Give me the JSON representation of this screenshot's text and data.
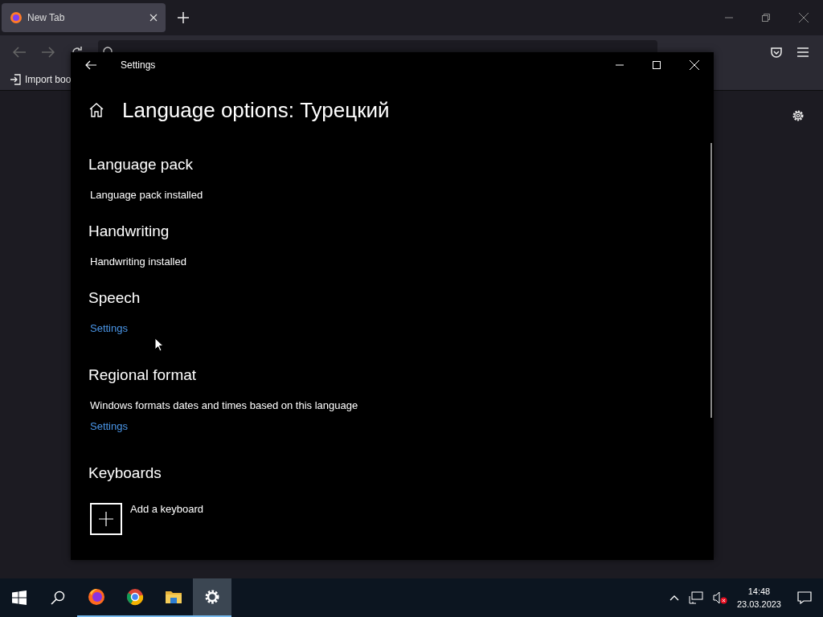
{
  "browser": {
    "tabs": [
      {
        "label": "New Tab",
        "selected": true
      }
    ],
    "bookmarks": [
      {
        "label": "Import boo"
      }
    ]
  },
  "settings_window": {
    "title": "Settings",
    "heading": "Language options: Турецкий",
    "sections": [
      {
        "title": "Language pack",
        "items": [
          {
            "kind": "text",
            "text": "Language pack installed"
          }
        ]
      },
      {
        "title": "Handwriting",
        "items": [
          {
            "kind": "text",
            "text": "Handwriting installed"
          }
        ]
      },
      {
        "title": "Speech",
        "items": [
          {
            "kind": "link",
            "text": "Settings"
          }
        ]
      },
      {
        "title": "Regional format",
        "items": [
          {
            "kind": "text",
            "text": "Windows formats dates and times based on this language"
          },
          {
            "kind": "link",
            "text": "Settings"
          }
        ]
      },
      {
        "title": "Keyboards",
        "items": [
          {
            "kind": "add",
            "text": "Add a keyboard"
          }
        ]
      }
    ]
  },
  "taskbar": {
    "apps": [
      {
        "kind": "firefox",
        "selected": false
      },
      {
        "kind": "chrome",
        "selected": false
      },
      {
        "kind": "explorer",
        "selected": false
      },
      {
        "kind": "settings",
        "selected": true
      }
    ],
    "clock": {
      "time": "14:48",
      "date": "23.03.2023"
    }
  }
}
